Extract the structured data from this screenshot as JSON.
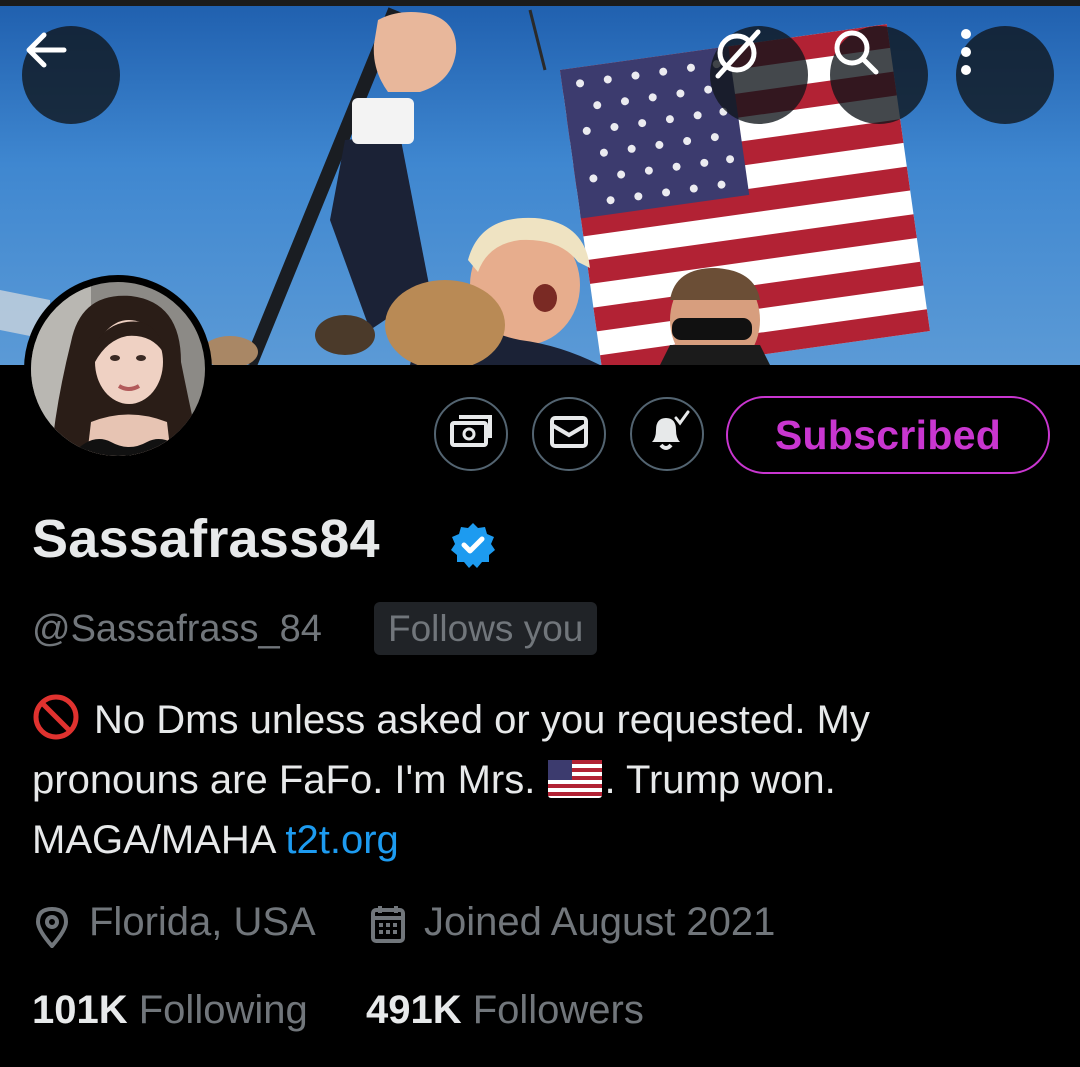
{
  "header": {
    "back_icon": "arrow-left-icon",
    "grok_icon": "grok-icon",
    "search_icon": "search-icon",
    "more_icon": "more-vertical-icon",
    "banner_description_icon": "profile-banner-image"
  },
  "actions": {
    "tip_icon": "money-icon",
    "message_icon": "mail-icon",
    "notify_icon": "bell-check-icon",
    "subscribed_label": "Subscribed"
  },
  "profile": {
    "display_name": "Sassafrass84",
    "handle": "@Sassafrass_84",
    "follows_you": "Follows you",
    "bio": {
      "line1": "No Dms unless asked or you requested. My",
      "line2_before_flag": "pronouns are FaFo. I'm Mrs.",
      "line2_after_flag": ". Trump won.",
      "line3_text": "MAGA/MAHA",
      "link": "t2t.org"
    },
    "location": "Florida, USA",
    "joined": "Joined August 2021",
    "following_count": "101K",
    "following_label": "Following",
    "followers_count": "491K",
    "followers_label": "Followers"
  },
  "colors": {
    "background": "#000000",
    "text_primary": "#e7e9ea",
    "text_secondary": "#71767b",
    "link": "#1d9bf0",
    "subscribed": "#c936d0",
    "verified": "#1d9bf0"
  }
}
